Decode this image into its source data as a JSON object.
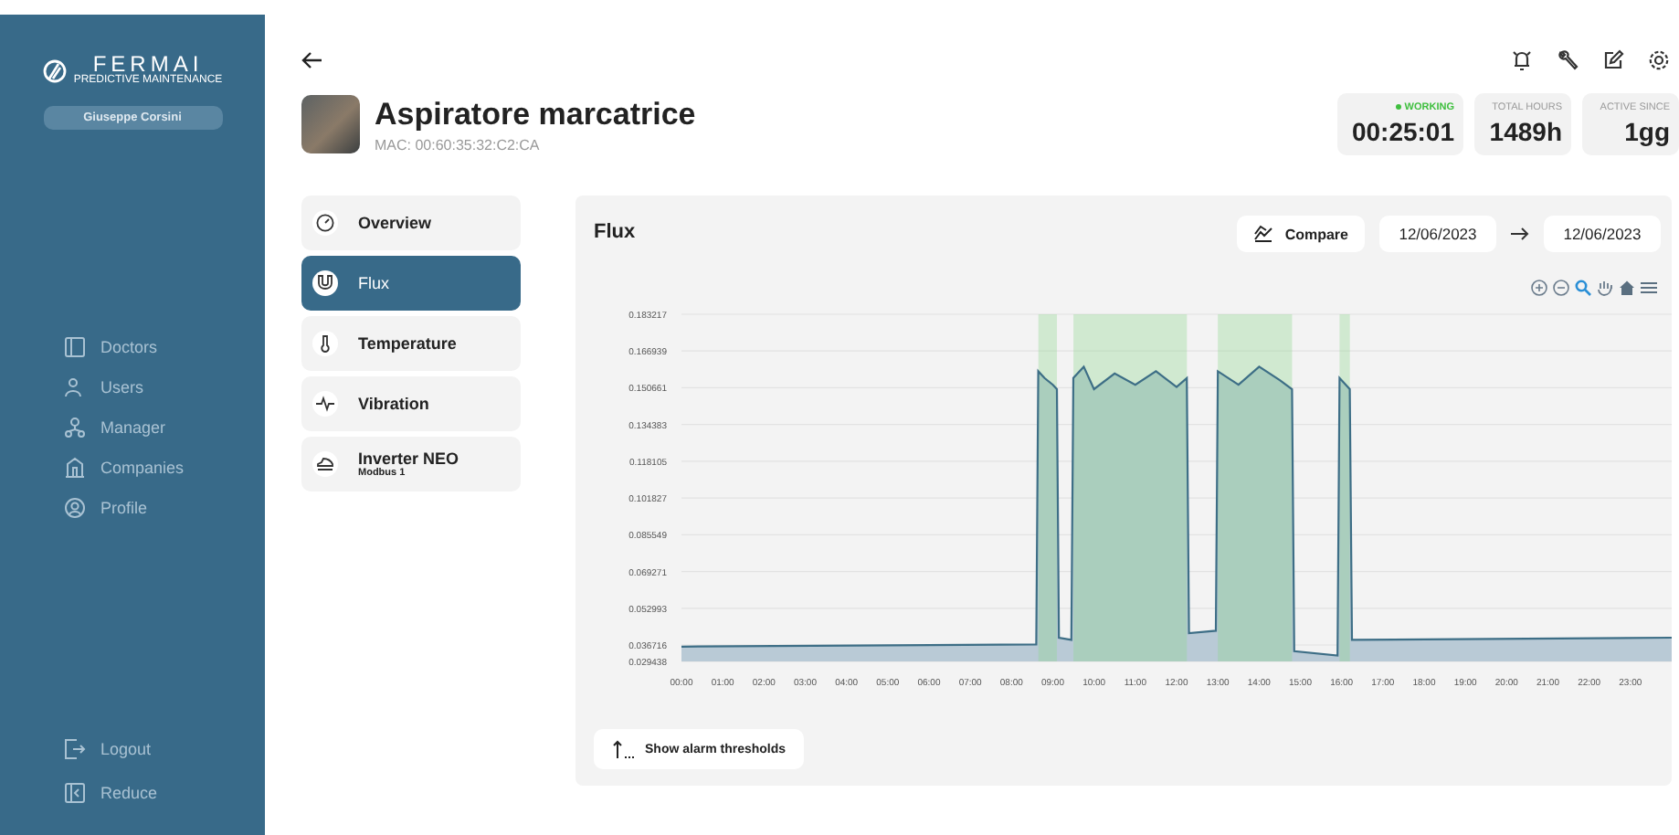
{
  "sidebar": {
    "logo": "FERMAI",
    "logo_subtitle": "PREDICTIVE MAINTENANCE",
    "user": "Giuseppe Corsini",
    "nav": [
      {
        "label": "Doctors"
      },
      {
        "label": "Users"
      },
      {
        "label": "Manager"
      },
      {
        "label": "Companies"
      },
      {
        "label": "Profile"
      }
    ],
    "footer": [
      {
        "label": "Logout"
      },
      {
        "label": "Reduce"
      }
    ]
  },
  "device": {
    "name": "Aspiratore marcatrice",
    "mac": "MAC: 00:60:35:32:C2:CA"
  },
  "stats": [
    {
      "kind": "status",
      "label": "WORKING",
      "value": "00:25:01"
    },
    {
      "kind": "plain",
      "label": "TOTAL HOURS",
      "value": "1489h"
    },
    {
      "kind": "plain",
      "label": "ACTIVE SINCE",
      "value": "1gg"
    }
  ],
  "sensors": [
    {
      "label": "Overview",
      "selected": false
    },
    {
      "label": "Flux",
      "selected": true
    },
    {
      "label": "Temperature",
      "selected": false
    },
    {
      "label": "Vibration",
      "selected": false
    },
    {
      "label": "Inverter NEO",
      "sublabel": "Modbus 1",
      "selected": false
    }
  ],
  "panel": {
    "title": "Flux",
    "compare_button": "Compare",
    "date_from": "12/06/2023",
    "date_to": "12/06/2023",
    "alarm_button": "Show alarm thresholds",
    "chart_data": {
      "type": "area",
      "xlim": [
        0,
        24
      ],
      "ylim": [
        0.029438,
        0.183217
      ],
      "x": [
        0,
        8.6,
        8.65,
        8.8,
        9.0,
        9.1,
        9.15,
        9.45,
        9.5,
        9.75,
        10.0,
        10.5,
        11.0,
        11.5,
        12.0,
        12.25,
        12.3,
        12.95,
        13.0,
        13.5,
        14.0,
        14.5,
        14.8,
        14.85,
        15.9,
        15.95,
        16.2,
        16.25,
        24
      ],
      "grid": true,
      "series": [
        {
          "color": "#3d6e86",
          "values": [
            0.036,
            0.037,
            0.158,
            0.155,
            0.152,
            0.15,
            0.04,
            0.039,
            0.155,
            0.16,
            0.15,
            0.157,
            0.152,
            0.158,
            0.151,
            0.155,
            0.042,
            0.043,
            0.158,
            0.152,
            0.16,
            0.154,
            0.15,
            0.034,
            0.032,
            0.155,
            0.15,
            0.039,
            0.04
          ]
        }
      ],
      "yticks": [
        0.029438,
        0.036716,
        0.052993,
        0.069271,
        0.085549,
        0.101827,
        0.118105,
        0.134383,
        0.150661,
        0.166939,
        0.183217
      ],
      "xticks": [
        {
          "value": 0,
          "label": "00:00"
        },
        {
          "value": 1,
          "label": "01:00"
        },
        {
          "value": 2,
          "label": "02:00"
        },
        {
          "value": 3,
          "label": "03:00"
        },
        {
          "value": 4,
          "label": "04:00"
        },
        {
          "value": 5,
          "label": "05:00"
        },
        {
          "value": 6,
          "label": "06:00"
        },
        {
          "value": 7,
          "label": "07:00"
        },
        {
          "value": 8,
          "label": "08:00"
        },
        {
          "value": 9,
          "label": "09:00"
        },
        {
          "value": 10,
          "label": "10:00"
        },
        {
          "value": 11,
          "label": "11:00"
        },
        {
          "value": 12,
          "label": "12:00"
        },
        {
          "value": 13,
          "label": "13:00"
        },
        {
          "value": 14,
          "label": "14:00"
        },
        {
          "value": 15,
          "label": "15:00"
        },
        {
          "value": 16,
          "label": "16:00"
        },
        {
          "value": 17,
          "label": "17:00"
        },
        {
          "value": 18,
          "label": "18:00"
        },
        {
          "value": 19,
          "label": "19:00"
        },
        {
          "value": 20,
          "label": "20:00"
        },
        {
          "value": 21,
          "label": "21:00"
        },
        {
          "value": 22,
          "label": "22:00"
        },
        {
          "value": 23,
          "label": "23:00"
        }
      ],
      "bands": [
        {
          "axis": "x",
          "from": 8.65,
          "to": 9.1
        },
        {
          "axis": "x",
          "from": 9.5,
          "to": 12.25
        },
        {
          "axis": "x",
          "from": 13.0,
          "to": 14.8
        },
        {
          "axis": "x",
          "from": 15.95,
          "to": 16.2
        }
      ]
    }
  }
}
